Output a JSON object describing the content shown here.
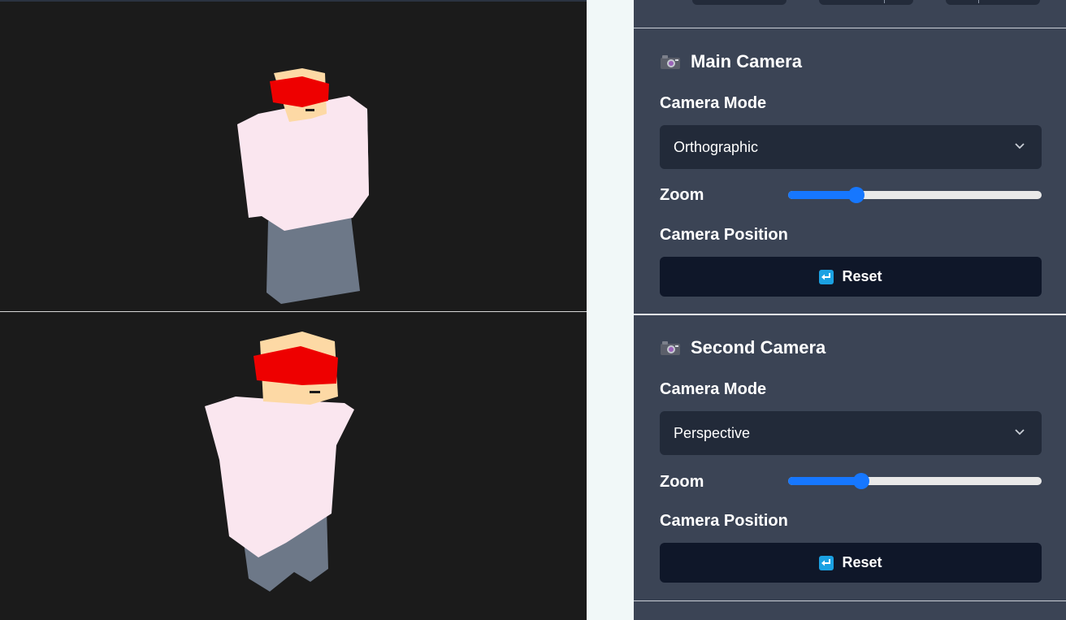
{
  "colors": {
    "viewport_bg": "#1b1b1b",
    "panel_bg": "#3b4455",
    "select_bg": "#222a39",
    "button_bg": "#0f1729",
    "accent": "#1677ff",
    "shirt": "#fae6ef",
    "pants": "#6d7888",
    "skin": "#fdd9a5",
    "headband": "#ee0000"
  },
  "cameras": [
    {
      "title": "Main Camera",
      "icon": "camera-icon",
      "mode_label": "Camera Mode",
      "mode_value": "Orthographic",
      "zoom_label": "Zoom",
      "zoom_value": 0.27,
      "position_label": "Camera Position",
      "reset_label": "Reset",
      "reset_icon": "return-arrow-icon"
    },
    {
      "title": "Second Camera",
      "icon": "camera-icon",
      "mode_label": "Camera Mode",
      "mode_value": "Perspective",
      "zoom_label": "Zoom",
      "zoom_value": 0.29,
      "position_label": "Camera Position",
      "reset_label": "Reset",
      "reset_icon": "return-arrow-icon"
    }
  ]
}
